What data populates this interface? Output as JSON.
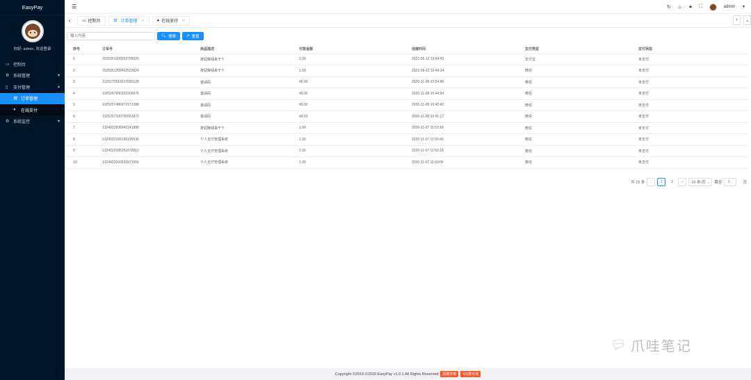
{
  "brand": {
    "title": "EasyPay"
  },
  "profile": {
    "welcome": "你好: admin, 欢迎登录"
  },
  "sidebar": {
    "items": [
      {
        "icon": "dashboard-icon",
        "label": "控制台"
      },
      {
        "icon": "settings-icon",
        "label": "系统管理"
      },
      {
        "icon": "payment-icon",
        "label": "支付管理"
      },
      {
        "icon": "cart-icon",
        "label": "订单管理"
      },
      {
        "icon": "pay-icon",
        "label": "在线支付"
      },
      {
        "icon": "monitor-icon",
        "label": "系统监控"
      }
    ]
  },
  "header": {
    "username": "admin"
  },
  "tabs": [
    {
      "label": "控制台"
    },
    {
      "label": "订单管理"
    },
    {
      "label": "在线支付"
    }
  ],
  "search": {
    "placeholder": "输入内容",
    "search_label": "搜索",
    "reset_label": "重置"
  },
  "table": {
    "columns": [
      "序号",
      "订单号",
      "商品描述",
      "付款金额",
      "创建时间",
      "支付类型",
      "支付状态"
    ],
    "rows": [
      [
        "1",
        "1535951206562795520",
        "按钮赚钱来干个",
        "1.00",
        "2022-06-12 19:44:43",
        "支付宝",
        "未支付"
      ],
      [
        "2",
        "1535951209402522624",
        "按钮赚钱来干个",
        "1.00",
        "2022-06-12 19:44:14",
        "微信",
        "未支付"
      ],
      [
        "3",
        "1325270512617680128",
        "邀请码",
        "49.00",
        "2020-11-08 10:54:48",
        "微信",
        "未支付"
      ],
      [
        "4",
        "1325267930302206976",
        "邀请码",
        "49.00",
        "2020-11-08 10:44:34",
        "微信",
        "未支付"
      ],
      [
        "5",
        "1325267486972172288",
        "邀请码",
        "49.00",
        "2020-11-08 10:42:42",
        "微信",
        "未支付"
      ],
      [
        "6",
        "1325267100705551872",
        "邀请码",
        "49.00",
        "2020-11-08 10:41:17",
        "微信",
        "未支付"
      ],
      [
        "7",
        "1324922838943141888",
        "按钮赚钱来干个",
        "1.00",
        "2020-11-07 11:53:18",
        "微信",
        "未支付"
      ],
      [
        "8",
        "1324922183106195536",
        "个人支付管理系统",
        "1.00",
        "2020-11-07 11:50:40",
        "微信",
        "未支付"
      ],
      [
        "9",
        "1324922095251878912",
        "个人支付管理系统",
        "1.00",
        "2020-11-07 11:50:18",
        "微信",
        "未支付"
      ],
      [
        "10",
        "1324922042620973056",
        "个人支付管理系统",
        "1.00",
        "2020-11-07 11:50:06",
        "微信",
        "未支付"
      ]
    ]
  },
  "pagination": {
    "total_label": "共 15 条",
    "pages": [
      "1",
      "2"
    ],
    "current": "1",
    "page_size": "10 条/页",
    "jump_label": "跳至",
    "jump_value": "1",
    "page_unit": "页"
  },
  "watermark": {
    "text": "爪哇笔记"
  },
  "footer": {
    "copyright": "Copyright ©2019-©2020 EasyPay v1.0.1 All Rights Reserved",
    "badge1": "捐赠作者",
    "badge2": "QQ群交流"
  }
}
